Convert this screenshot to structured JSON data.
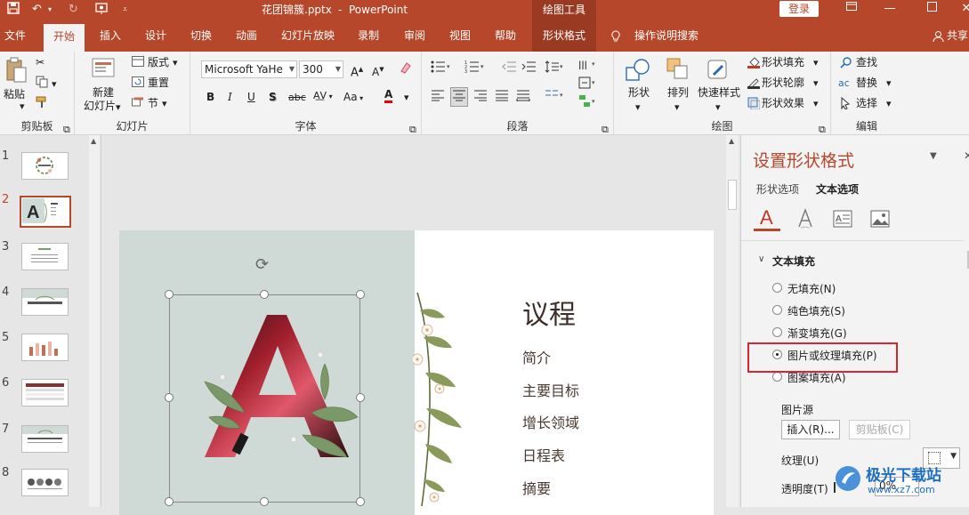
{
  "titlebar": {
    "filename": "花团锦簇.pptx",
    "separator": "-",
    "app": "PowerPoint",
    "context_tab_header": "绘图工具",
    "login": "登录"
  },
  "tabs": [
    "文件",
    "开始",
    "插入",
    "设计",
    "切换",
    "动画",
    "幻灯片放映",
    "录制",
    "审阅",
    "视图",
    "帮助",
    "形状格式"
  ],
  "tell_me": "操作说明搜索",
  "share": "共享",
  "ribbon": {
    "clipboard": {
      "paste": "粘贴",
      "label": "剪贴板"
    },
    "slides": {
      "new_slide": "新建\n幻灯片",
      "new_slide_l1": "新建",
      "new_slide_l2": "幻灯片",
      "layout": "版式",
      "reset": "重置",
      "section": "节",
      "label": "幻灯片"
    },
    "font": {
      "font_name": "Microsoft YaHe",
      "font_size": "300",
      "label": "字体"
    },
    "paragraph": {
      "label": "段落"
    },
    "drawing": {
      "shapes": "形状",
      "arrange": "排列",
      "quick_styles": "快速样式",
      "fill": "形状填充",
      "outline": "形状轮廓",
      "effects": "形状效果",
      "label": "绘图"
    },
    "editing": {
      "find": "查找",
      "replace": "替换",
      "select": "选择",
      "label": "编辑"
    }
  },
  "thumbnails": [
    "1",
    "2",
    "3",
    "4",
    "5",
    "6",
    "7",
    "8"
  ],
  "selected_slide": 2,
  "slide": {
    "big_letter": "A",
    "title": "议程",
    "items": [
      "简介",
      "主要目标",
      "增长领域",
      "日程表",
      "摘要"
    ]
  },
  "format_panel": {
    "title": "设置形状格式",
    "tab_shape": "形状选项",
    "tab_text": "文本选项",
    "section": "文本填充",
    "options": [
      "无填充(N)",
      "纯色填充(S)",
      "渐变填充(G)",
      "图片或纹理填充(P)",
      "图案填充(A)"
    ],
    "selected_option": 3,
    "picture_source": "图片源",
    "insert_btn": "插入(R)...",
    "clipboard_btn": "剪贴板(C)",
    "texture_label": "纹理(U)",
    "transparency_label": "透明度(T)",
    "transparency_value": "0%"
  },
  "watermark": {
    "brand": "极光下载站",
    "url": "www.xz7.com"
  },
  "colors": {
    "accent": "#b7472a",
    "highlight_box": "#d9262c"
  }
}
